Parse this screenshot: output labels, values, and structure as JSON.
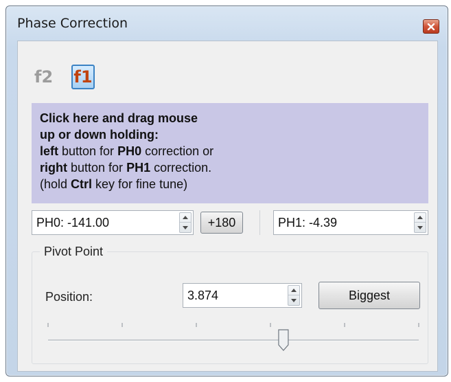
{
  "window": {
    "title": "Phase Correction",
    "close_icon": "close-icon"
  },
  "mode_buttons": [
    {
      "label": "f2",
      "selected": false
    },
    {
      "label": "f1",
      "selected": true
    }
  ],
  "instructions": {
    "line1": "Click here and drag mouse",
    "line2": "up or down holding:",
    "line3_bold": "left",
    "line3_a": " button for ",
    "line3_bold2": "PH0",
    "line3_b": " correction or",
    "line4_bold": "right",
    "line4_a": " button for ",
    "line4_bold2": "PH1",
    "line4_b": " correction.",
    "line5_a": "(hold ",
    "line5_bold": "Ctrl",
    "line5_b": " key for fine tune)",
    "background": "#c9c7e6"
  },
  "ph0": {
    "value": "PH0: -141.00"
  },
  "plus180": {
    "label": "+180"
  },
  "ph1": {
    "value": "PH1: -4.39"
  },
  "pivot": {
    "group_title": "Pivot Point",
    "position_label": "Position:",
    "position_value": "3.874",
    "biggest_label": "Biggest",
    "slider_fraction": 0.635
  }
}
